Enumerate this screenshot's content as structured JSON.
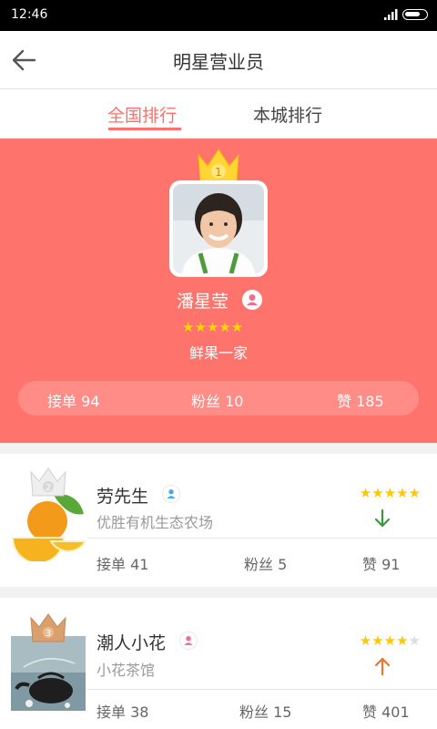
{
  "status": {
    "time": "12:46"
  },
  "header": {
    "title": "明星营业员"
  },
  "tabs": [
    {
      "label": "全国排行",
      "active": true
    },
    {
      "label": "本城排行",
      "active": false
    }
  ],
  "top": {
    "rank": "1",
    "name": "潘星莹",
    "stars": "★★★★★",
    "shop": "鲜果一家",
    "stats": {
      "orders": "接单 94",
      "fans": "粉丝 10",
      "likes": "赞 185"
    }
  },
  "list": [
    {
      "rank": "2",
      "name": "劳先生",
      "shop": "优胜有机生态农场",
      "stars_on": "★★★★★",
      "stars_off": "",
      "trend": "down",
      "stats": {
        "orders": "接单 41",
        "fans": "粉丝 5",
        "likes": "赞 91"
      }
    },
    {
      "rank": "3",
      "name": "潮人小花",
      "shop": "小花茶馆",
      "stars_on": "★★★★",
      "stars_off": "★",
      "trend": "up",
      "stats": {
        "orders": "接单 38",
        "fans": "粉丝 15",
        "likes": "赞 401"
      }
    }
  ],
  "colors": {
    "accent": "#ff6f6b",
    "hero_bg": "#ff736d",
    "star": "#ffc800",
    "trend_down": "#3a9a3a",
    "trend_up": "#e8762c"
  }
}
